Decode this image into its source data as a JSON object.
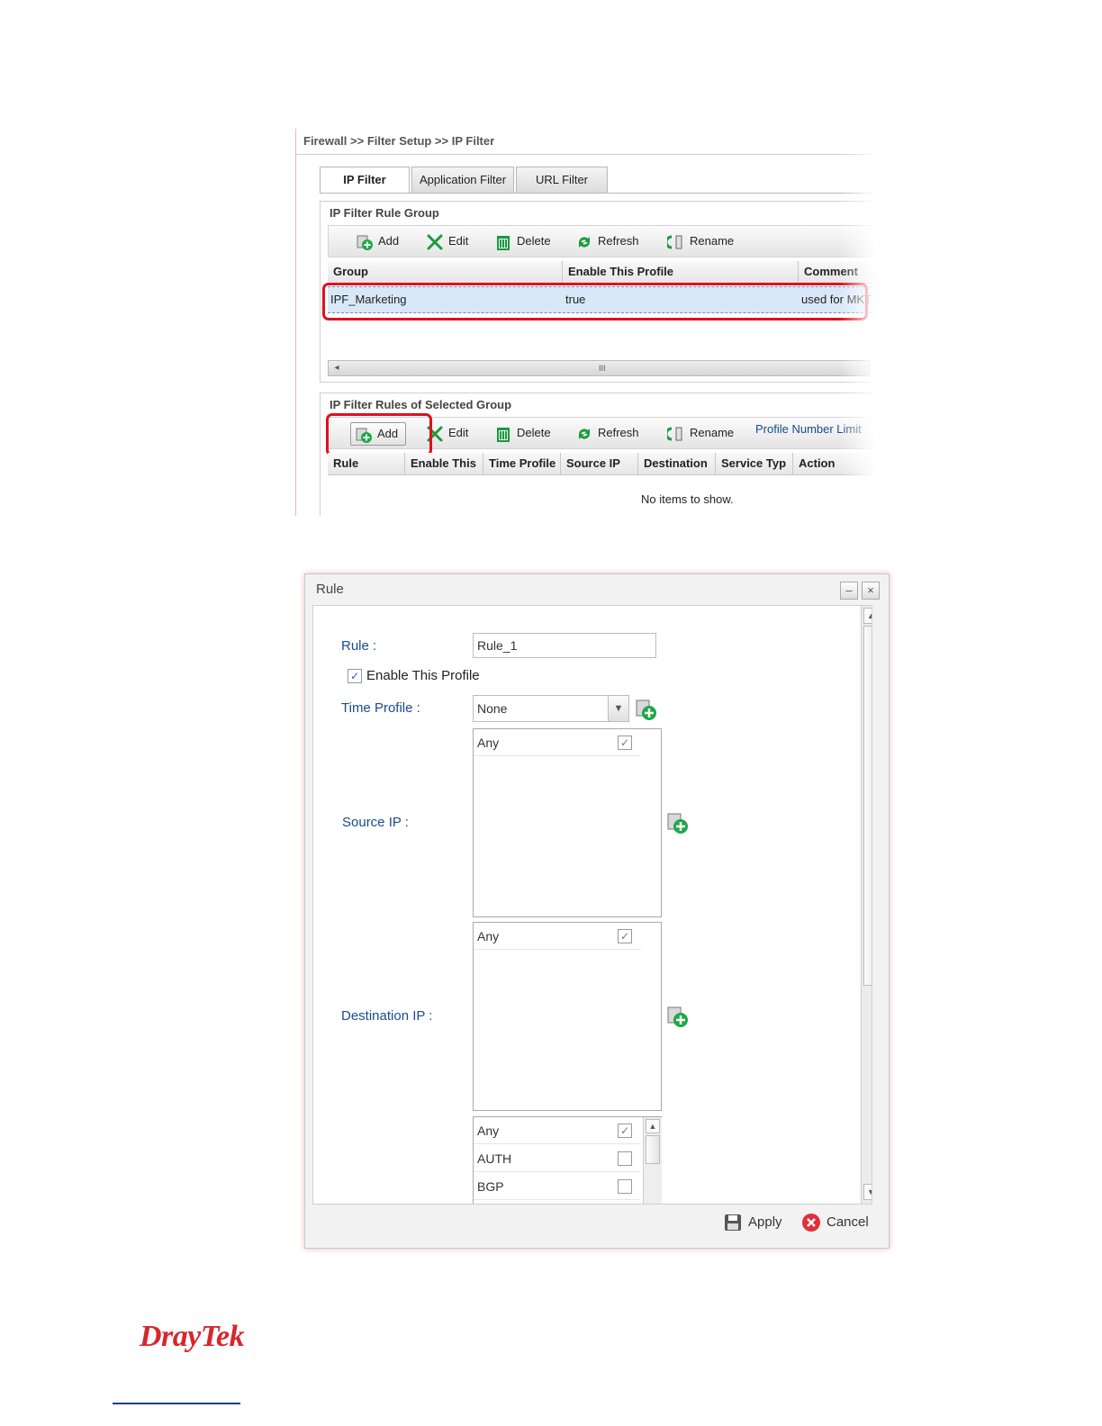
{
  "breadcrumb": "Firewall >> Filter Setup >> IP Filter",
  "tabs": [
    "IP Filter",
    "Application Filter",
    "URL Filter"
  ],
  "group_section": {
    "title": "IP Filter Rule Group",
    "toolbar": {
      "add": "Add",
      "edit": "Edit",
      "delete": "Delete",
      "refresh": "Refresh",
      "rename": "Rename"
    },
    "columns": [
      "Group",
      "Enable This Profile",
      "Comment"
    ],
    "rows": [
      {
        "group": "IPF_Marketing",
        "enabled": "true",
        "comment": "used for MKT"
      }
    ],
    "scroll_mark": "III"
  },
  "rules_section": {
    "title": "IP Filter Rules of Selected Group",
    "toolbar": {
      "add": "Add",
      "edit": "Edit",
      "delete": "Delete",
      "refresh": "Refresh",
      "rename": "Rename",
      "limit": "Profile Number Limit"
    },
    "columns": [
      "Rule",
      "Enable This",
      "Time Profile",
      "Source IP",
      "Destination",
      "Service Typ",
      "Action"
    ],
    "empty": "No items to show."
  },
  "dialog": {
    "title": "Rule",
    "minimize": "–",
    "close": "×",
    "rule_label": "Rule :",
    "rule_value": "Rule_1",
    "enable_label": "Enable This Profile",
    "enable_checked": "✓",
    "time_label": "Time Profile :",
    "time_value": "None",
    "source_label": "Source IP :",
    "source_items": [
      {
        "name": "Any",
        "check": "✓"
      }
    ],
    "dest_label": "Destination IP :",
    "dest_items": [
      {
        "name": "Any",
        "check": "✓"
      }
    ],
    "service_items": [
      {
        "name": "Any",
        "check": "✓"
      },
      {
        "name": "AUTH",
        "check": ""
      },
      {
        "name": "BGP",
        "check": ""
      }
    ],
    "apply": "Apply",
    "cancel": "Cancel"
  },
  "brand": "DrayTek",
  "colors": {
    "accent_red": "#e0101e",
    "label_blue": "#1a4b8c",
    "brand_red": "#d7262c",
    "selection": "#d9e8f8"
  }
}
